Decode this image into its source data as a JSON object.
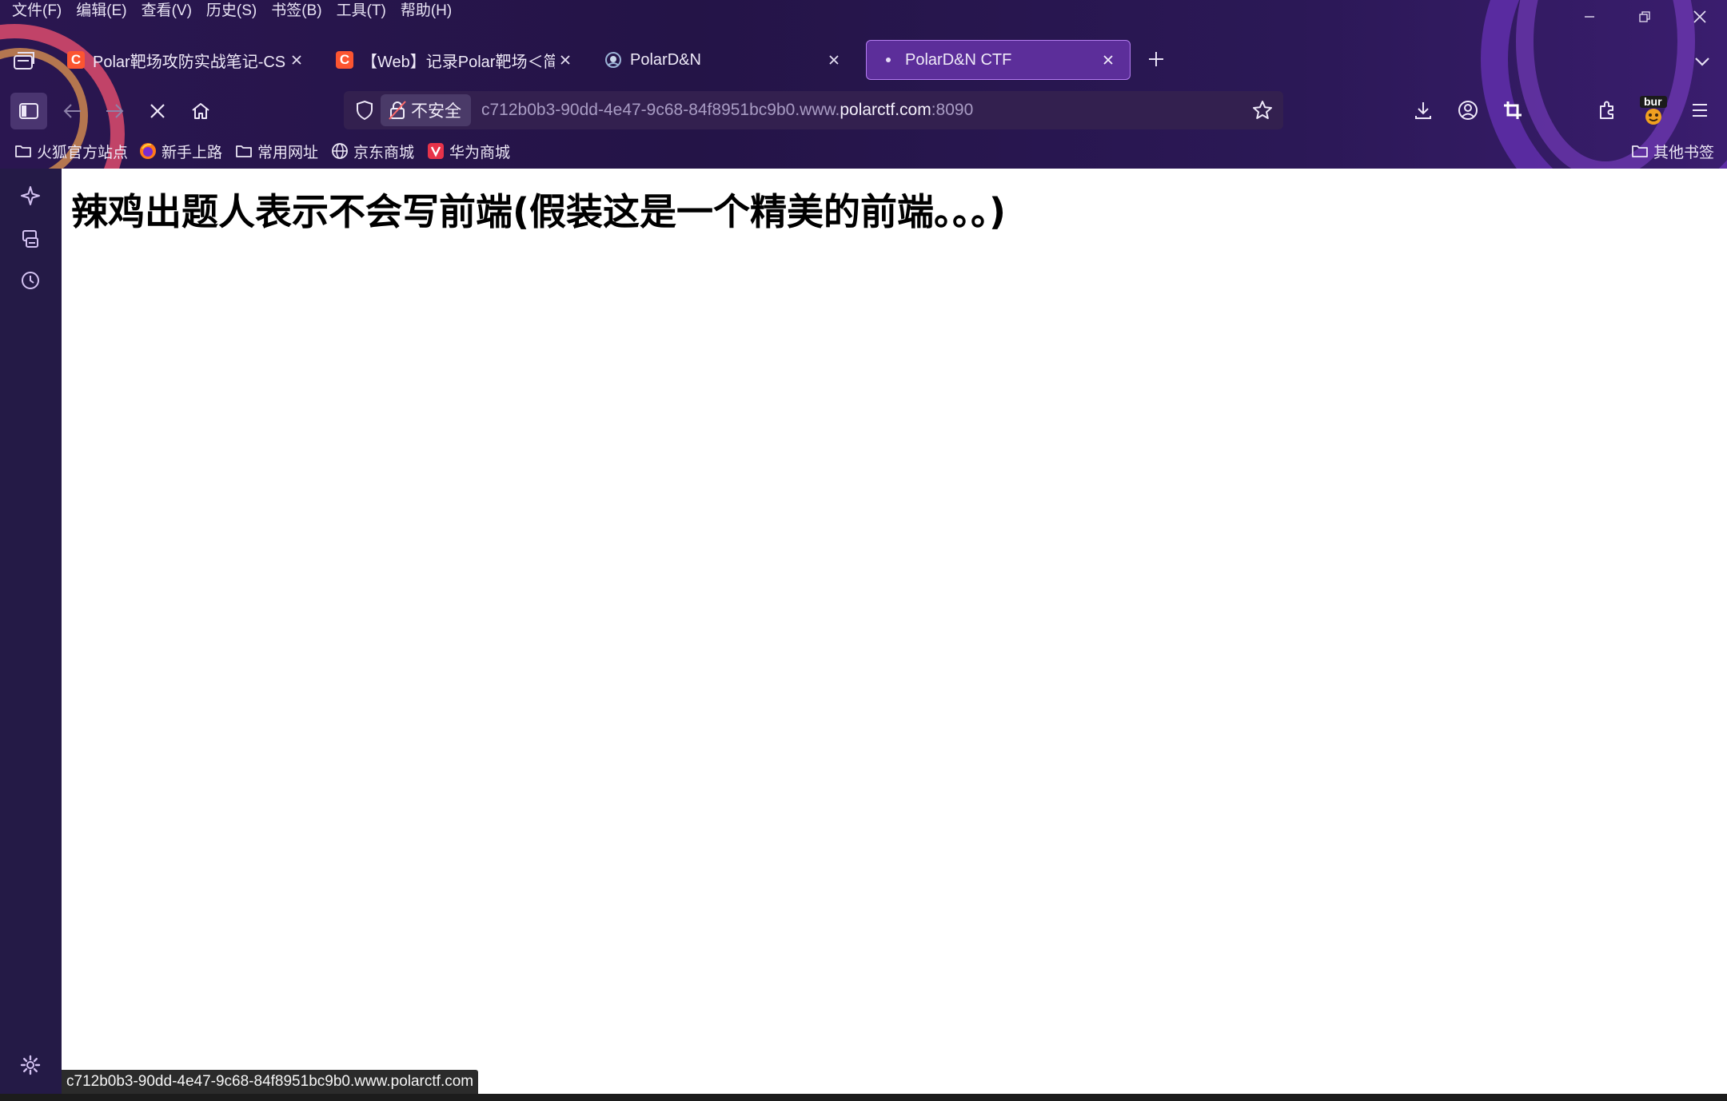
{
  "menubar": {
    "items": [
      "文件(F)",
      "编辑(E)",
      "查看(V)",
      "历史(S)",
      "书签(B)",
      "工具(T)",
      "帮助(H)"
    ]
  },
  "tabs": [
    {
      "label": "Polar靶场攻防实战笔记-CSDN博客",
      "favicon": "csdn-icon",
      "favicon_color": "#fc5531"
    },
    {
      "label": "【Web】记录Polar靶场＜简单",
      "favicon": "csdn-icon",
      "favicon_color": "#fc5531"
    },
    {
      "label": "PolarD&N",
      "favicon": "polar-icon",
      "favicon_color": "#8fa7c9"
    },
    {
      "label": "PolarD&N CTF",
      "favicon": "loading-dot-icon",
      "active": true
    }
  ],
  "navbar": {
    "security_label": "不安全",
    "url_prefix": "c712b0b3-90dd-4e47-9c68-84f8951bc9b0.www.",
    "url_domain": "polarctf.com",
    "url_suffix": ":8090"
  },
  "bookmarks": {
    "items": [
      {
        "label": "火狐官方站点",
        "icon": "folder-icon"
      },
      {
        "label": "新手上路",
        "icon": "firefox-icon"
      },
      {
        "label": "常用网址",
        "icon": "folder-icon"
      },
      {
        "label": "京东商城",
        "icon": "globe-icon"
      },
      {
        "label": "华为商城",
        "icon": "vmall-icon"
      }
    ],
    "other": "其他书签"
  },
  "extension_badge": "bur",
  "page": {
    "heading": "辣鸡出题人表示不会写前端(假装这是一个精美的前端。。。)"
  },
  "status": {
    "text": "c712b0b3-90dd-4e47-9c68-84f8951bc9b0.www.polarctf.com"
  },
  "colors": {
    "chrome_bg": "#2a1650",
    "active_tab": "#5c2e9a",
    "content_bg": "#ffffff"
  }
}
